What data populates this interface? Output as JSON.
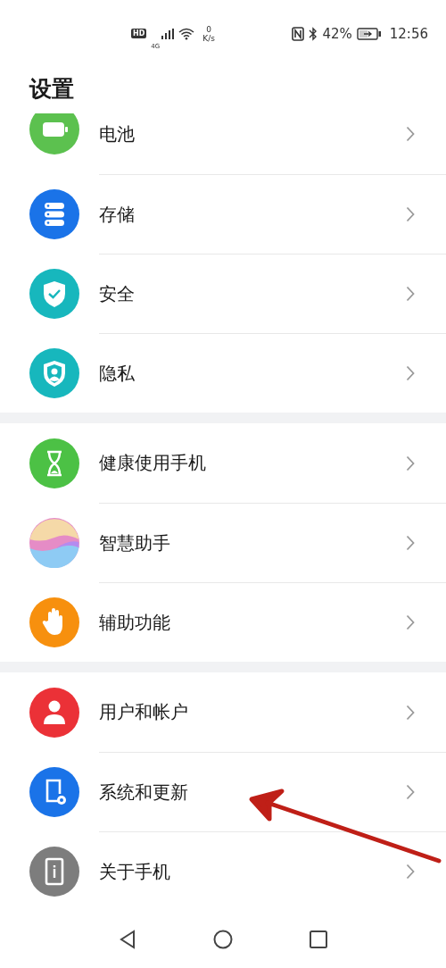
{
  "status_bar": {
    "hd": "HD",
    "network": "4G",
    "speed_value": "0",
    "speed_unit": "K/s",
    "battery_percent": "42%",
    "time": "12:56"
  },
  "title": "设置",
  "groups": [
    {
      "items": [
        {
          "label": "电池",
          "kind": "battery",
          "color": "#5cc14f"
        },
        {
          "label": "存储",
          "kind": "storage",
          "color": "#1a73e8"
        },
        {
          "label": "安全",
          "kind": "security",
          "color": "#17b7bd"
        },
        {
          "label": "隐私",
          "kind": "privacy",
          "color": "#17b7bd"
        }
      ]
    },
    {
      "items": [
        {
          "label": "健康使用手机",
          "kind": "hourglass",
          "color": "#4cc145"
        },
        {
          "label": "智慧助手",
          "kind": "assistant",
          "color": "#e58cc6"
        },
        {
          "label": "辅助功能",
          "kind": "hand",
          "color": "#f7900e"
        }
      ]
    },
    {
      "items": [
        {
          "label": "用户和帐户",
          "kind": "user",
          "color": "#eb3137"
        },
        {
          "label": "系统和更新",
          "kind": "system",
          "color": "#1a73e8"
        },
        {
          "label": "关于手机",
          "kind": "about",
          "color": "#7d7d7d"
        }
      ]
    }
  ]
}
